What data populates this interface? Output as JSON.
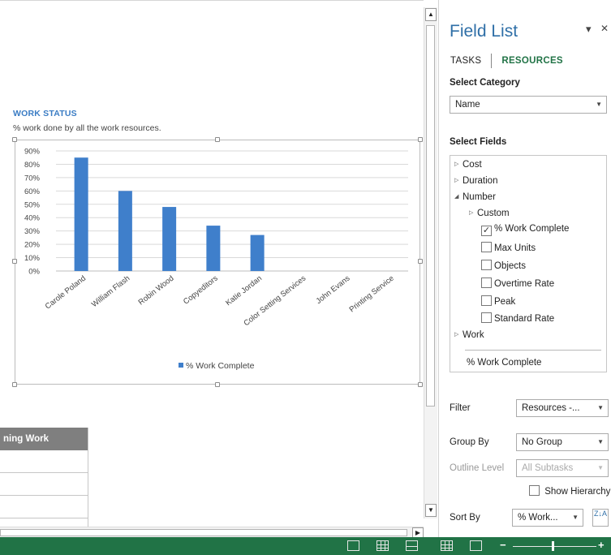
{
  "report": {
    "chart_title": "WORK STATUS",
    "chart_subtitle": "% work done by all the work resources.",
    "table_header": "ning Work"
  },
  "chart_data": {
    "type": "bar",
    "categories": [
      "Carole Poland",
      "William Flash",
      "Robin Wood",
      "Copyeditors",
      "Katie Jordan",
      "Color Setting Services",
      "John Evans",
      "Printing Service"
    ],
    "series": [
      {
        "name": "% Work Complete",
        "values": [
          85,
          60,
          48,
          34,
          27,
          0,
          0,
          0
        ],
        "color": "#3f7fcb"
      }
    ],
    "y_ticks": [
      "0%",
      "10%",
      "20%",
      "30%",
      "40%",
      "50%",
      "60%",
      "70%",
      "80%",
      "90%"
    ],
    "ylim": [
      0,
      90
    ],
    "grid": true,
    "legend_placement": "bottom"
  },
  "field_list": {
    "title": "Field List",
    "close_glyph": "✕",
    "menu_glyph": "▾",
    "tabs": {
      "tasks": "TASKS",
      "resources": "RESOURCES"
    },
    "select_category_label": "Select Category",
    "category_value": "Name",
    "select_fields_label": "Select Fields",
    "fields": {
      "cost": "Cost",
      "duration": "Duration",
      "number": "Number",
      "custom": "Custom",
      "work_complete": "% Work Complete",
      "max_units": "Max Units",
      "objects": "Objects",
      "overtime_rate": "Overtime Rate",
      "peak": "Peak",
      "standard_rate": "Standard Rate",
      "work": "Work",
      "selected_field": "% Work Complete"
    },
    "filter_label": "Filter",
    "filter_value": "Resources -...",
    "group_by_label": "Group By",
    "group_by_value": "No Group",
    "outline_level_label": "Outline Level",
    "outline_level_value": "All Subtasks",
    "show_hierarchy_label": "Show Hierarchy",
    "sort_by_label": "Sort By",
    "sort_by_value": "% Work...",
    "sort_glyph": "Z↓A"
  },
  "statusbar": {
    "zoom_minus": "−",
    "zoom_plus": "+"
  }
}
